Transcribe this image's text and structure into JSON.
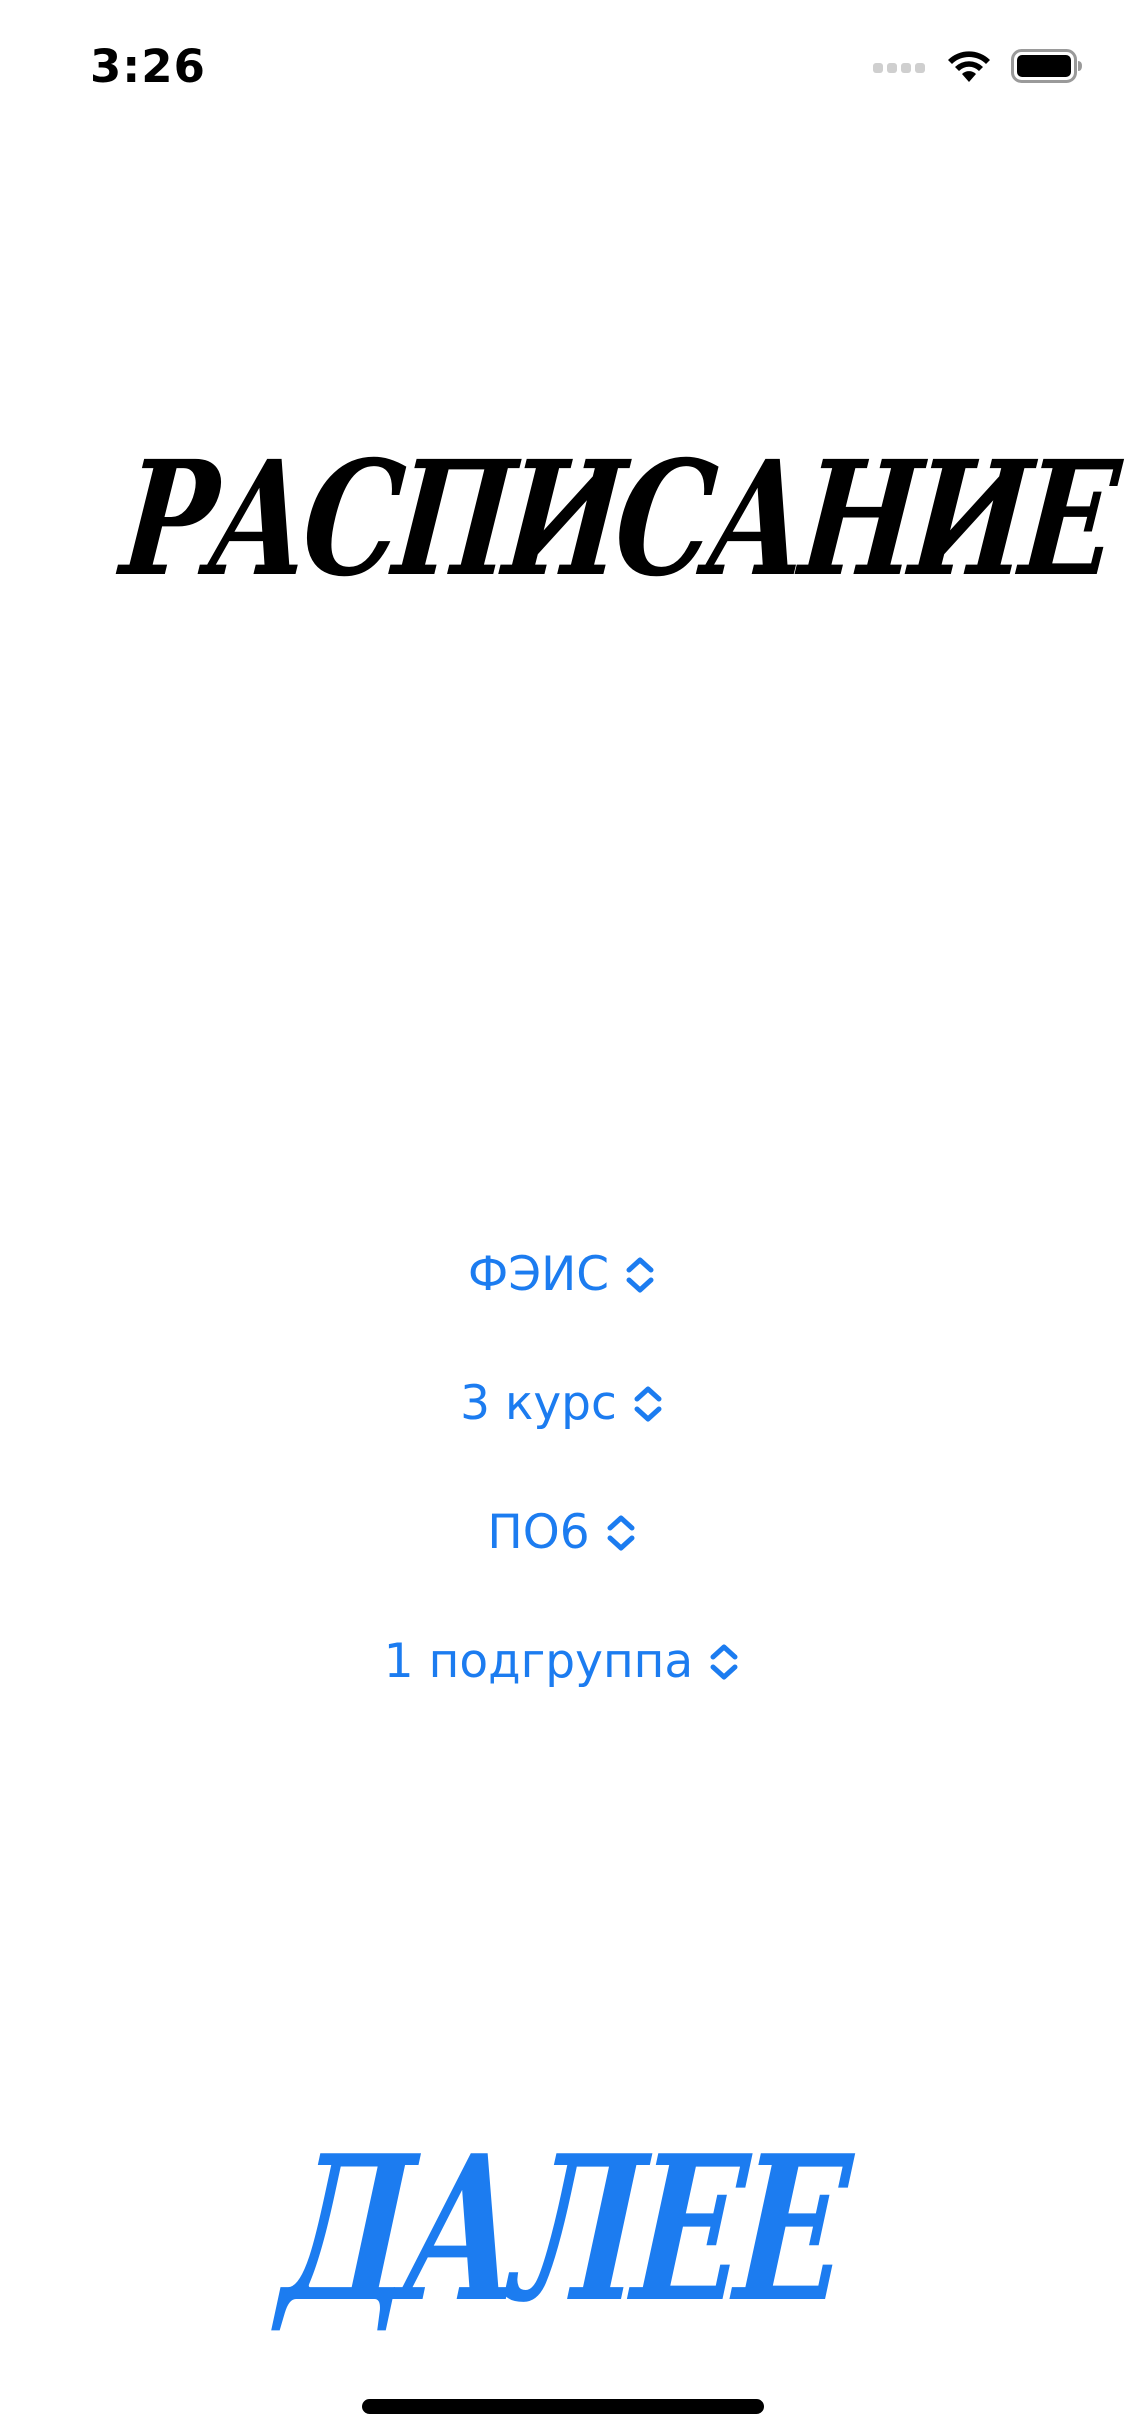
{
  "status_bar": {
    "time": "3:26",
    "icons": [
      "signal-icon",
      "wifi-icon",
      "battery-icon"
    ]
  },
  "title": "РАСПИСАНИЕ",
  "pickers": [
    {
      "label": "ФЭИС",
      "icon": "chevron-up-down-icon"
    },
    {
      "label": "3 курс",
      "icon": "chevron-up-down-icon"
    },
    {
      "label": "ПО6",
      "icon": "chevron-up-down-icon"
    },
    {
      "label": "1 подгруппа",
      "icon": "chevron-up-down-icon"
    }
  ],
  "next_button": {
    "label": "ДАЛЕЕ"
  },
  "colors": {
    "accent": "#1c7cf0",
    "text": "#000000",
    "background": "#ffffff"
  }
}
